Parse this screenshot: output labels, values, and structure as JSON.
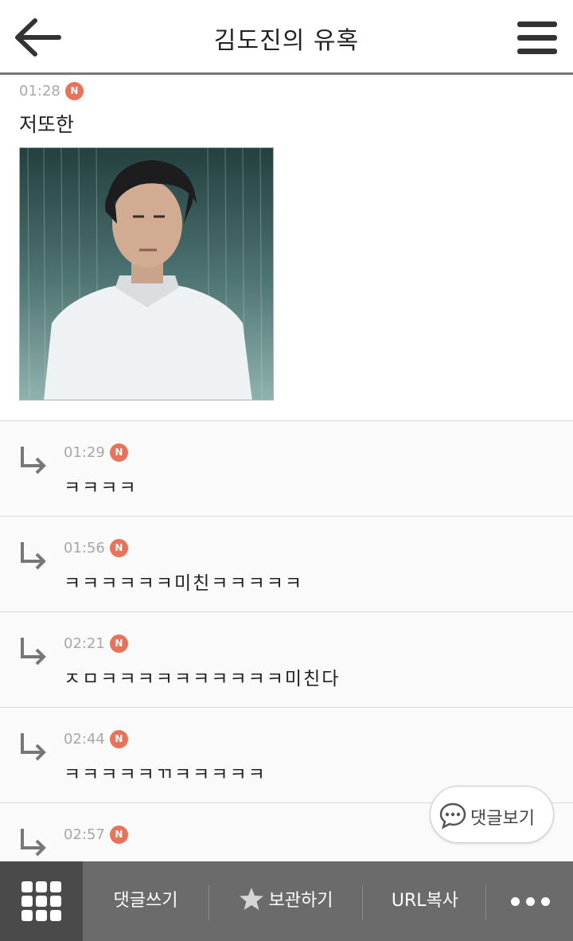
{
  "header": {
    "title": "김도진의 유혹",
    "back_icon": "arrow-left-icon",
    "menu_icon": "hamburger-icon"
  },
  "post": {
    "time": "01:28",
    "badge": "N",
    "text": "저또한",
    "image_alt": "man-in-rain-photo"
  },
  "replies": [
    {
      "time": "01:29",
      "badge": "N",
      "text": "ㅋㅋㅋㅋ"
    },
    {
      "time": "01:56",
      "badge": "N",
      "text": "ㅋㅋㅋㅋㅋㅋ미친ㅋㅋㅋㅋㅋ"
    },
    {
      "time": "02:21",
      "badge": "N",
      "text": "ㅈㅁㅋㅋㅋㅋㅋㅋㅋㅋㅋㅋ미친다"
    },
    {
      "time": "02:44",
      "badge": "N",
      "text": "ㅋㅋㅋㅋㅋㄲㅋㅋㅋㅋㅋ"
    },
    {
      "time": "02:57",
      "badge": "N",
      "text": ""
    }
  ],
  "floating": {
    "view_comments_label": "댓글보기",
    "icon": "chat-bubble-icon"
  },
  "bottom_bar": {
    "grid_icon": "grid-icon",
    "write_comment": "댓글쓰기",
    "bookmark": "보관하기",
    "bookmark_icon": "star-icon",
    "copy_url": "URL복사",
    "more_icon": "more-dots-icon"
  },
  "colors": {
    "badge": "#e8735a",
    "bottom_bar": "#6b6b6b",
    "bottom_bar_grid": "#4a4a4a",
    "timestamp": "#a8a8a8"
  }
}
